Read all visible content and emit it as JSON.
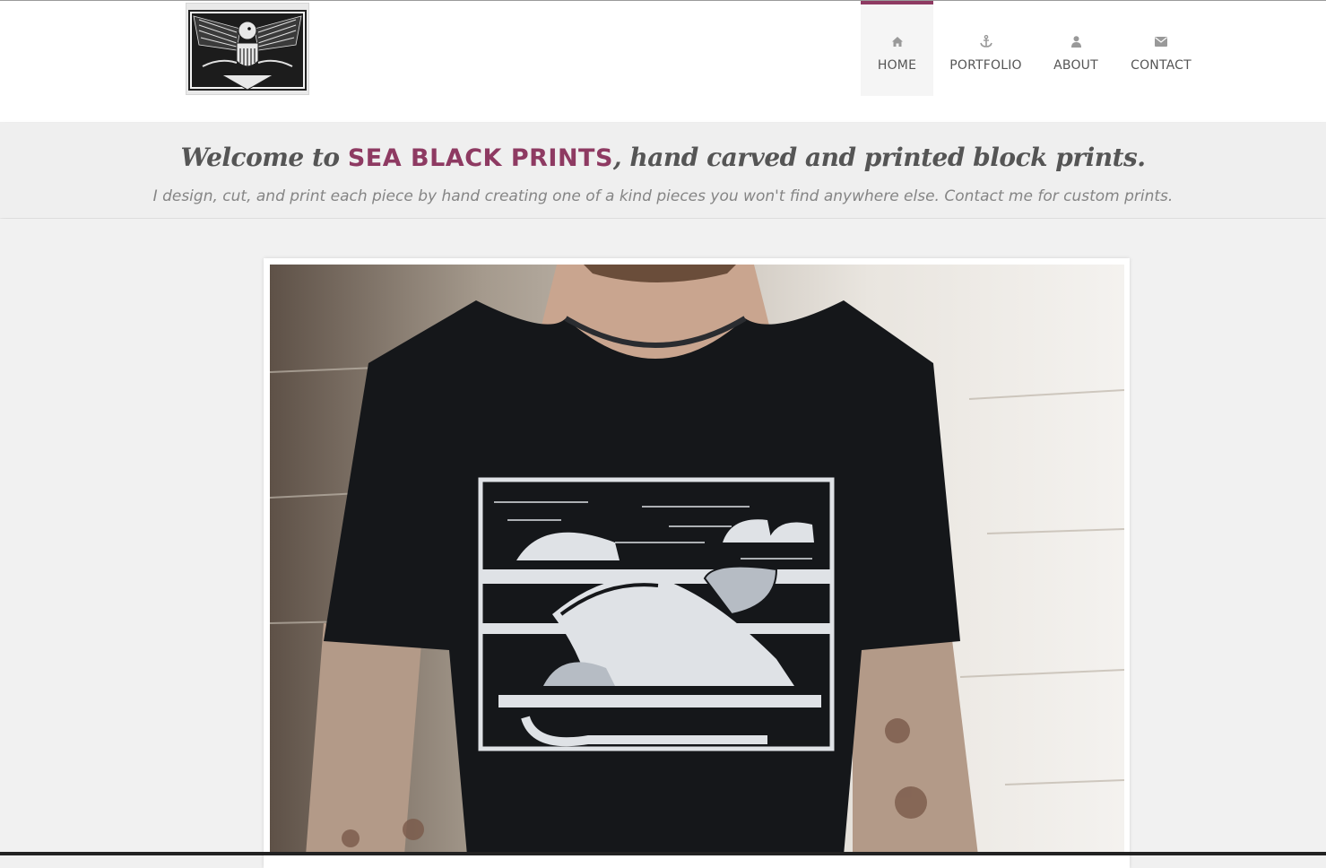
{
  "nav": {
    "items": [
      {
        "label": "HOME",
        "icon": "home-icon",
        "active": true
      },
      {
        "label": "PORTFOLIO",
        "icon": "anchor-icon",
        "active": false
      },
      {
        "label": "ABOUT",
        "icon": "user-icon",
        "active": false
      },
      {
        "label": "CONTACT",
        "icon": "envelope-icon",
        "active": false
      }
    ]
  },
  "welcome": {
    "prefix": "Welcome to ",
    "brand": "SEA BLACK PRINTS",
    "suffix": ", hand carved and printed block prints.",
    "tagline": "I design, cut, and print each piece by hand creating one of a kind pieces you won't find anywhere else. Contact me for custom prints."
  },
  "colors": {
    "accent": "#8e3a62",
    "text": "#555555",
    "muted": "#858585"
  }
}
